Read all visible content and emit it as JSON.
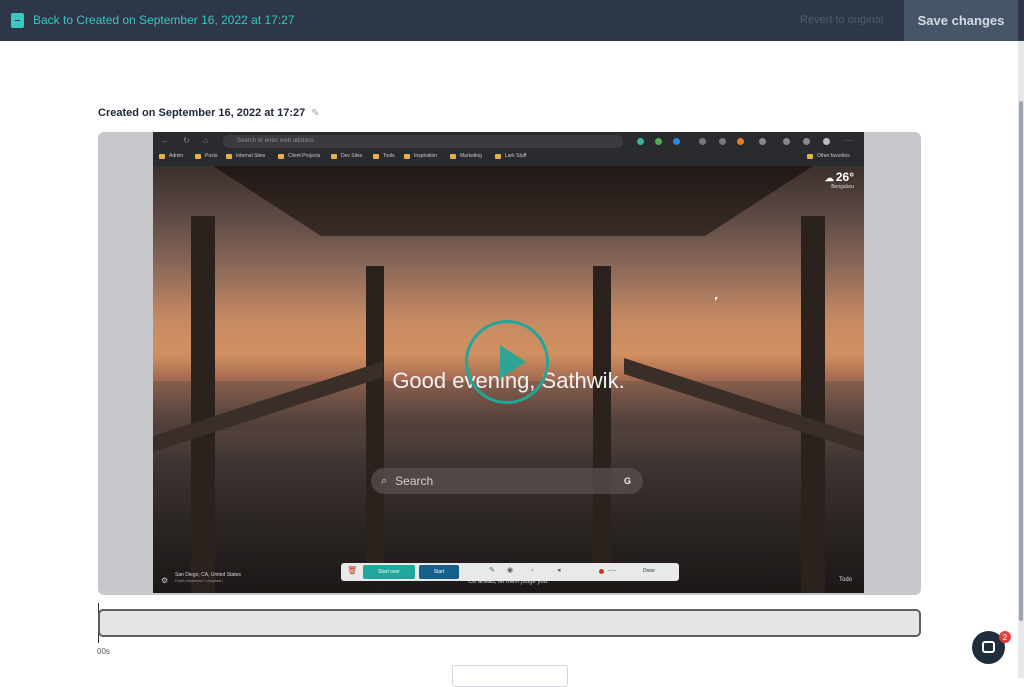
{
  "topbar": {
    "back_label": "Back to Created on September 16, 2022 at 17:27",
    "revert_label": "Revert to original",
    "save_label": "Save changes"
  },
  "recording": {
    "title": "Created on September 16, 2022 at 17:27"
  },
  "video": {
    "browser": {
      "address_placeholder": "Search or enter web address",
      "bookmarks": [
        "Admin",
        "Posts",
        "Internal Sites",
        "Client Projects",
        "Dev Sites",
        "Tools",
        "Inspiration",
        "Marketing",
        "Lark Stuff"
      ],
      "other_favorites": "Other favorites"
    },
    "weather": {
      "temp": "26°",
      "city": "Bengaluru"
    },
    "greeting": "Good evening, Sathwik.",
    "search_placeholder": "Search",
    "toolbar": {
      "start_over": "Start over",
      "start": "Start",
      "timer": "--:--",
      "done": "Done"
    },
    "caption": "Go ahead, let them judge you.",
    "location": "San Diego, CA, United States",
    "photo_credit": "Frank Mckenna / Unsplash",
    "todo": "Todo"
  },
  "timeline": {
    "time_label": "00s"
  },
  "chat": {
    "badge_count": "2"
  },
  "colors": {
    "accent": "#38c7c1",
    "topbar": "#2d3748",
    "save_bg": "#475569",
    "play": "#1ea79a"
  }
}
